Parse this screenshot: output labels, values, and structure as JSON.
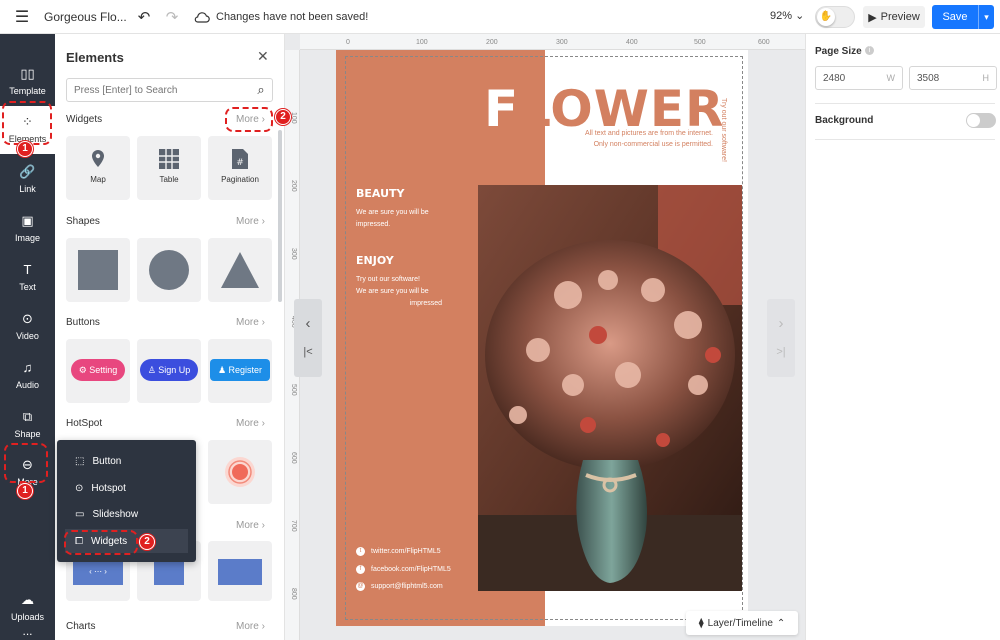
{
  "topbar": {
    "menu_icon": "hamburger-icon",
    "doc_title": "Gorgeous Flo...",
    "save_status": "Changes have not been saved!",
    "zoom": "92%",
    "preview_label": "Preview",
    "save_label": "Save"
  },
  "sidebar": {
    "items": [
      {
        "label": "Template",
        "icon": "template-icon"
      },
      {
        "label": "Elements",
        "icon": "elements-icon",
        "active": true
      },
      {
        "label": "Link",
        "icon": "link-icon"
      },
      {
        "label": "Image",
        "icon": "image-icon"
      },
      {
        "label": "Text",
        "icon": "text-icon"
      },
      {
        "label": "Video",
        "icon": "video-icon"
      },
      {
        "label": "Audio",
        "icon": "audio-icon"
      },
      {
        "label": "Shape",
        "icon": "shape-icon"
      },
      {
        "label": "More",
        "icon": "more-icon"
      },
      {
        "label": "Uploads",
        "icon": "uploads-icon"
      }
    ],
    "overflow": "..."
  },
  "panel": {
    "title": "Elements",
    "search_placeholder": "Press [Enter] to Search",
    "more_label": "More",
    "sections": {
      "widgets": {
        "title": "Widgets",
        "items": [
          "Map",
          "Table",
          "Pagination"
        ]
      },
      "shapes": {
        "title": "Shapes"
      },
      "buttons": {
        "title": "Buttons",
        "items": [
          "Setting",
          "Sign Up",
          "Register"
        ]
      },
      "hotspot": {
        "title": "HotSpot"
      },
      "charts": {
        "title": "Charts"
      }
    }
  },
  "context_menu": {
    "items": [
      "Button",
      "Hotspot",
      "Slideshow",
      "Widgets"
    ]
  },
  "ruler": {
    "top": [
      "0",
      "100",
      "200",
      "300",
      "400",
      "500",
      "600"
    ],
    "left": [
      "100",
      "200",
      "300",
      "400",
      "500",
      "600",
      "700",
      "800"
    ]
  },
  "page": {
    "headline": "FLOWER",
    "note_line1": "All text and pictures are from the internet.",
    "note_line2": "Only non-commercial use is permitted.",
    "vertical_text": "Try out our software!",
    "beauty_heading": "BEAUTY",
    "beauty_line1": "We are sure you will be",
    "beauty_line2": "impressed.",
    "enjoy_heading": "ENJOY",
    "enjoy_line1": "Try out our software!",
    "enjoy_line2": "We are sure you will be",
    "enjoy_line3": "impressed",
    "social": [
      "twitter.com/FlipHTML5",
      "facebook.com/FlipHTML5",
      "support@fliphtml5.com"
    ],
    "colors": {
      "terracotta": "#d38060"
    }
  },
  "layer_timeline_label": "Layer/Timeline",
  "right_panel": {
    "page_size_label": "Page Size",
    "width": "2480",
    "width_unit": "W",
    "height": "3508",
    "height_unit": "H",
    "background_label": "Background"
  },
  "annotations": [
    "1",
    "1",
    "2",
    "2"
  ],
  "accent_colors": {
    "primary": "#1677ff",
    "annotation": "#e02020",
    "sidebar": "#2d3440"
  }
}
